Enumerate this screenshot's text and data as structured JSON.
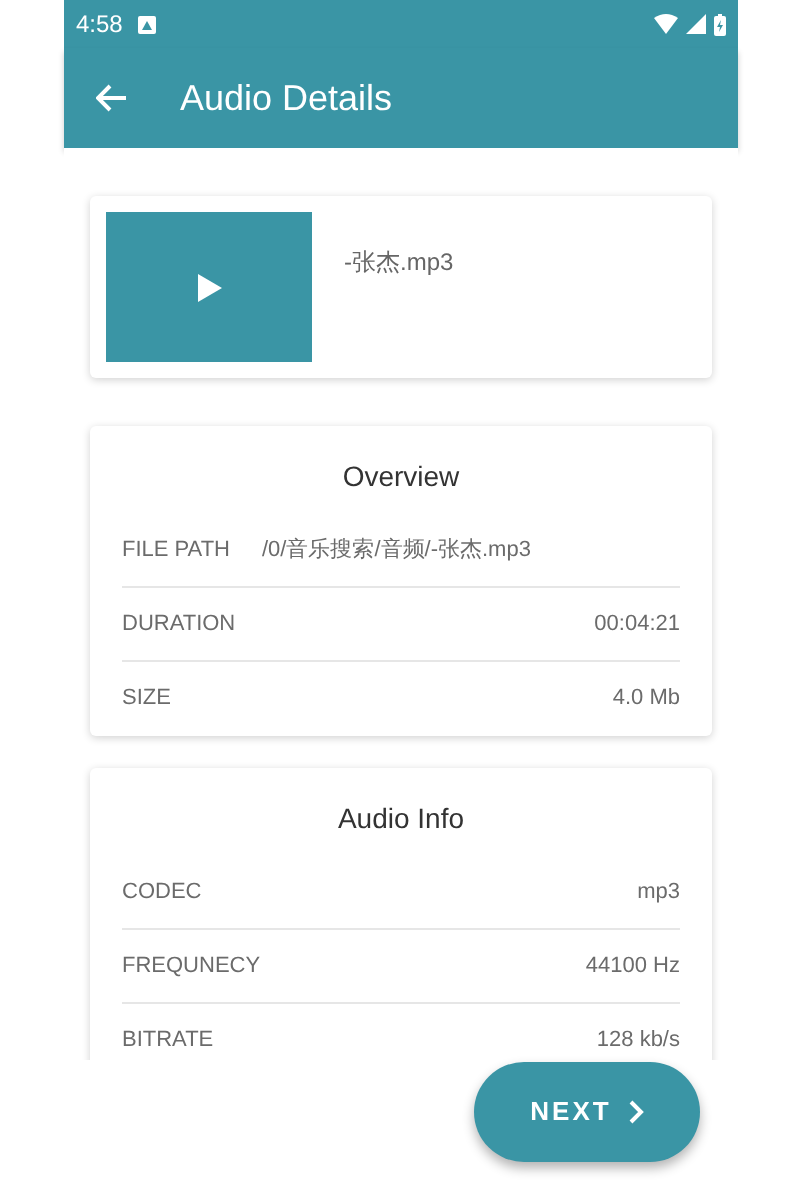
{
  "status_bar": {
    "time": "4:58"
  },
  "toolbar": {
    "title": "Audio Details"
  },
  "file": {
    "name": "-张杰.mp3"
  },
  "sections": [
    {
      "title": "Overview",
      "rows": [
        {
          "label": "FILE PATH",
          "value": "/0/音乐搜索/音频/-张杰.mp3",
          "kind": "inline"
        },
        {
          "label": "DURATION",
          "value": "00:04:21",
          "kind": "split"
        },
        {
          "label": "SIZE",
          "value": "4.0 Mb",
          "kind": "split"
        }
      ]
    },
    {
      "title": "Audio Info",
      "rows": [
        {
          "label": "CODEC",
          "value": "mp3",
          "kind": "split"
        },
        {
          "label": "FREQUNECY",
          "value": "44100 Hz",
          "kind": "split"
        },
        {
          "label": "BITRATE",
          "value": "128 kb/s",
          "kind": "split"
        }
      ]
    }
  ],
  "next_button": {
    "label": "NEXT"
  }
}
